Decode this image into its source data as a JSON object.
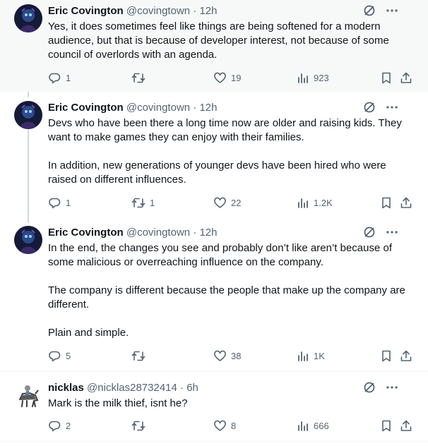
{
  "tweets": [
    {
      "name": "Eric Covington",
      "handle": "@covingtown",
      "time": "12h",
      "paragraphs": [
        "Yes, it does sometimes feel like things are being softened for a modern audience, but that is because of developer interest, not because of some council of overlords with an agenda."
      ],
      "replies": "1",
      "retweets": "",
      "likes": "19",
      "views": "923"
    },
    {
      "name": "Eric Covington",
      "handle": "@covingtown",
      "time": "12h",
      "paragraphs": [
        "Devs who have been there a long time now are older and raising kids. They want to make games they can enjoy with their families.",
        "In addition, new generations of younger devs have been hired who were raised on different influences."
      ],
      "replies": "1",
      "retweets": "1",
      "likes": "22",
      "views": "1.2K"
    },
    {
      "name": "Eric Covington",
      "handle": "@covingtown",
      "time": "12h",
      "paragraphs": [
        "In the end, the changes you see and probably don’t like aren’t because of some malicious or overreaching influence on the company.",
        "The company is different because the people that make up the company are different.",
        "Plain and simple."
      ],
      "replies": "5",
      "retweets": "",
      "likes": "38",
      "views": "1K"
    },
    {
      "name": "nicklas",
      "handle": "@nicklas28732414",
      "time": "6h",
      "paragraphs": [
        "Mark is the milk thief, isnt he?"
      ],
      "replies": "2",
      "retweets": "",
      "likes": "8",
      "views": "666"
    }
  ],
  "separator": "·",
  "colors": {
    "text": "#0f1419",
    "muted": "#536471",
    "highlight": "#f7f9f9",
    "thread_line": "#cfd9de"
  },
  "icons": [
    "grok-icon",
    "more-icon",
    "reply-icon",
    "retweet-icon",
    "like-icon",
    "views-icon",
    "bookmark-icon",
    "share-icon"
  ]
}
